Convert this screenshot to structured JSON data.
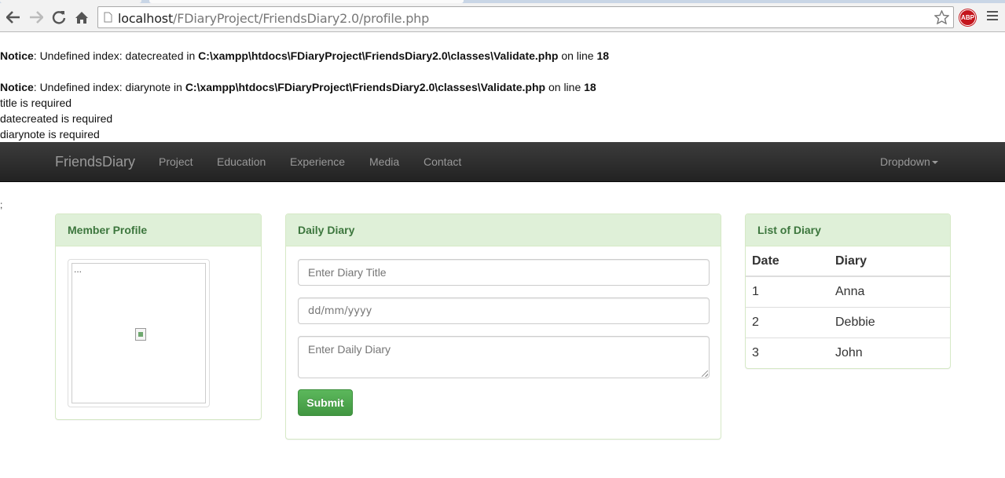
{
  "browser": {
    "url_host": "localhost",
    "url_path": "/FDiaryProject/FriendsDiary2.0/profile.php",
    "adblock_label": "ABP"
  },
  "notices": [
    {
      "label": "Notice",
      "message": ": Undefined index: datecreated in ",
      "path": "C:\\xampp\\htdocs\\FDiaryProject\\FriendsDiary2.0\\classes\\Validate.php",
      "on_line": " on line ",
      "line": "18"
    },
    {
      "label": "Notice",
      "message": ": Undefined index: diarynote in ",
      "path": "C:\\xampp\\htdocs\\FDiaryProject\\FriendsDiary2.0\\classes\\Validate.php",
      "on_line": " on line ",
      "line": "18"
    }
  ],
  "errors": [
    "title is required",
    "datecreated is required",
    "diarynote is required"
  ],
  "navbar": {
    "brand": "FriendsDiary",
    "links": [
      "Project",
      "Education",
      "Experience",
      "Media",
      "Contact"
    ],
    "dropdown": "Dropdown"
  },
  "stray_text": ";",
  "profile_panel": {
    "title": "Member Profile",
    "image_alt": "..."
  },
  "diary_panel": {
    "title": "Daily Diary",
    "title_placeholder": "Enter Diary Title",
    "date_placeholder": "dd/mm/yyyy",
    "note_placeholder": "Enter Daily Diary",
    "submit_label": "Submit"
  },
  "list_panel": {
    "title": "List of Diary",
    "columns": [
      "Date",
      "Diary"
    ],
    "rows": [
      [
        "1",
        "Anna"
      ],
      [
        "2",
        "Debbie"
      ],
      [
        "3",
        "John"
      ]
    ]
  },
  "colors": {
    "navbar": "#222222",
    "panel_heading_bg": "#dff0d8",
    "panel_heading_text": "#3c763d",
    "submit_button": "#5cb85c"
  }
}
